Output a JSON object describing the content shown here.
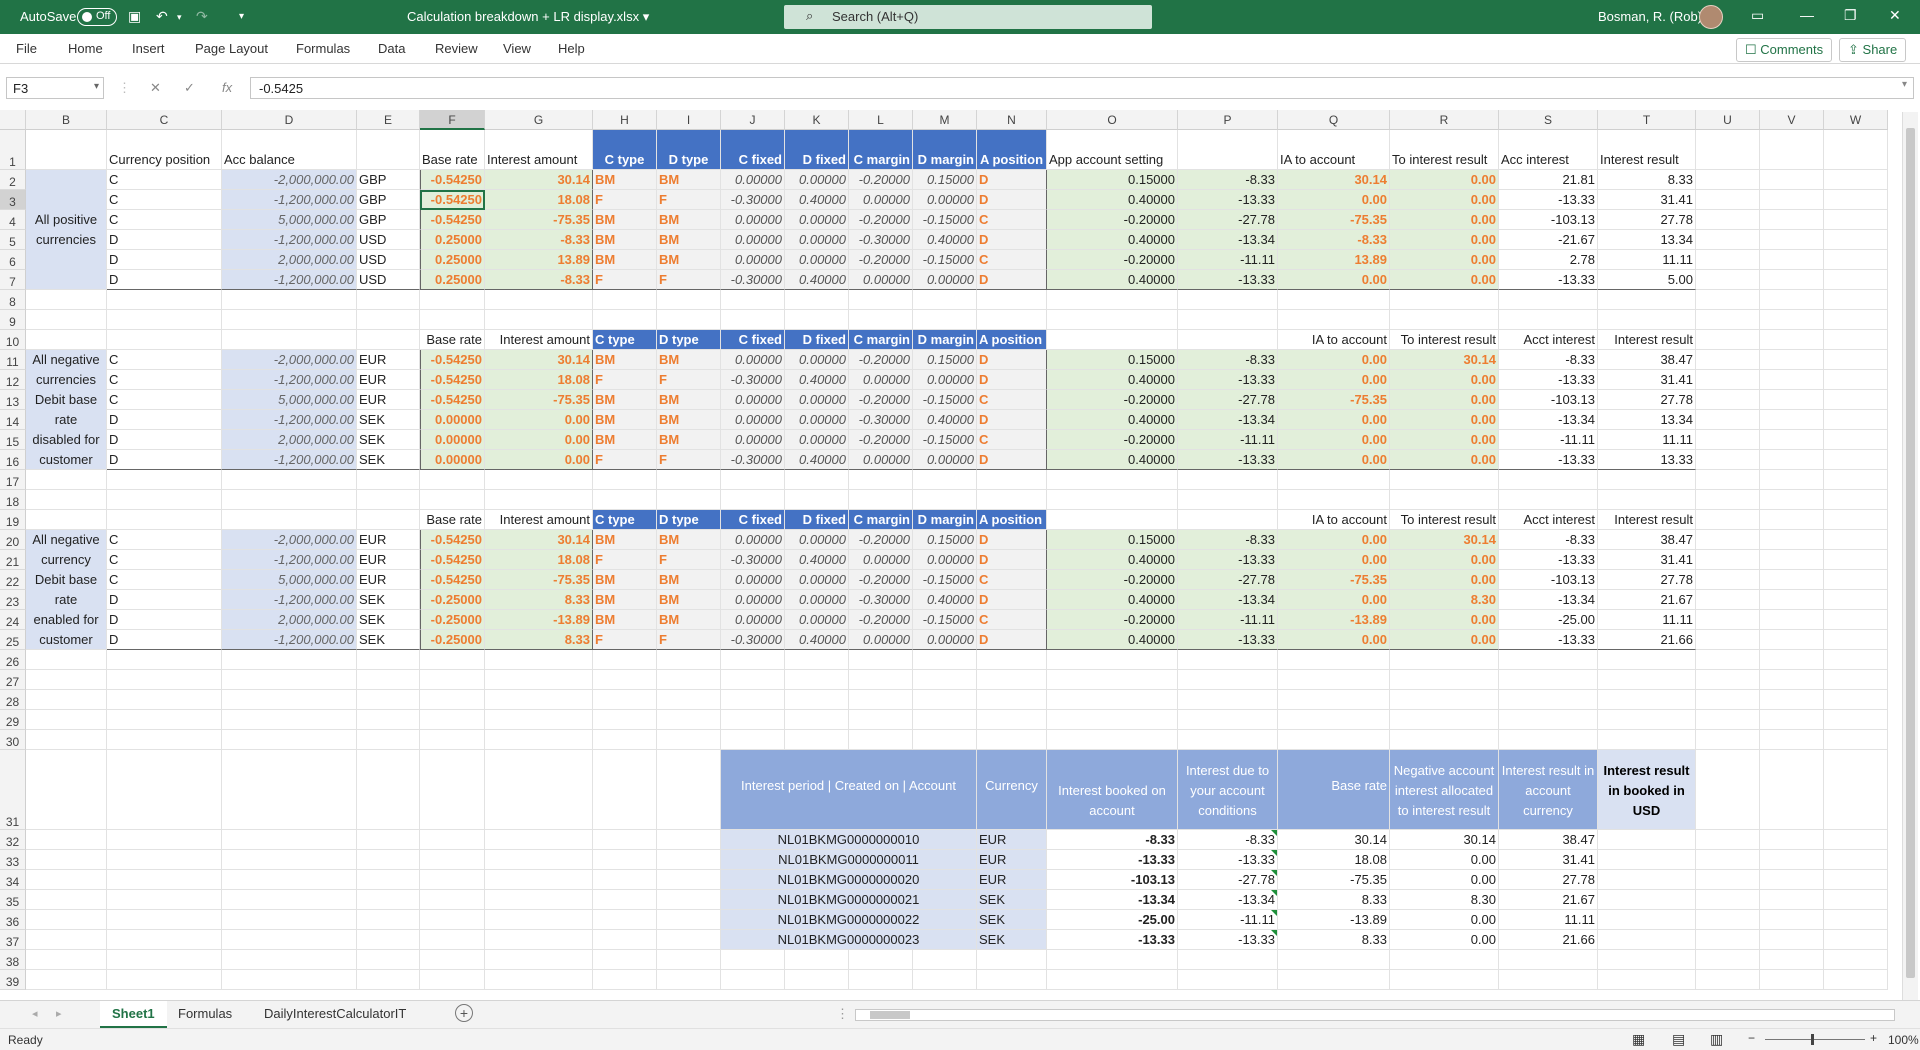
{
  "titlebar": {
    "autosave": "AutoSave",
    "autosave_state": "Off",
    "filename": "Calculation breakdown + LR display.xlsx",
    "search_placeholder": "Search (Alt+Q)",
    "user": "Bosman, R. (Rob)"
  },
  "menu": [
    "File",
    "Home",
    "Insert",
    "Page Layout",
    "Formulas",
    "Data",
    "Review",
    "View",
    "Help"
  ],
  "buttons": {
    "comments": "Comments",
    "share": "Share"
  },
  "formula_bar": {
    "name_box": "F3",
    "value": "-0.5425"
  },
  "columns": [
    "B",
    "C",
    "D",
    "E",
    "F",
    "G",
    "H",
    "I",
    "J",
    "K",
    "L",
    "M",
    "N",
    "O",
    "P",
    "Q",
    "R",
    "S",
    "T",
    "U",
    "V",
    "W"
  ],
  "rows": [
    "1",
    "2",
    "3",
    "4",
    "5",
    "6",
    "7",
    "8",
    "9",
    "10",
    "11",
    "12",
    "13",
    "14",
    "15",
    "16",
    "17",
    "18",
    "19",
    "20",
    "21",
    "22",
    "23",
    "24",
    "25",
    "26",
    "27",
    "28",
    "29",
    "30",
    "31",
    "32",
    "33",
    "34",
    "35",
    "36",
    "37",
    "38",
    "39"
  ],
  "header1": {
    "C": "Currency position",
    "D": "Acc balance",
    "F": "Base rate",
    "G": "Interest amount",
    "H": "C type",
    "I": "D type",
    "J": "C fixed",
    "K": "D fixed",
    "L": "C margin",
    "M": "D margin",
    "N": "A position",
    "O": "App account setting",
    "Q": "IA to account",
    "R": "To interest result",
    "S": "Acc interest",
    "T": "Interest result"
  },
  "header2": {
    "F": "Base rate",
    "G": "Interest amount",
    "H": "C type",
    "I": "D type",
    "J": "C fixed",
    "K": "D fixed",
    "L": "C margin",
    "M": "D margin",
    "N": "A position",
    "Q": "IA to account",
    "R": "To interest result",
    "S": "Acct interest",
    "T": "Interest result"
  },
  "group_labels": {
    "g1": [
      "All positive",
      "currencies"
    ],
    "g2": [
      "All negative",
      "currencies",
      "Debit base",
      "rate",
      "disabled for",
      "customer"
    ],
    "g3": [
      "All negative",
      "currency",
      "Debit base",
      "rate",
      "enabled for",
      "customer"
    ]
  },
  "block1": [
    [
      "C",
      "-2,000,000.00",
      "GBP",
      "-0.54250",
      "30.14",
      "BM",
      "BM",
      "0.00000",
      "0.00000",
      "-0.20000",
      "0.15000",
      "D",
      "0.15000",
      "-8.33",
      "30.14",
      "0.00",
      "21.81",
      "8.33"
    ],
    [
      "C",
      "-1,200,000.00",
      "GBP",
      "-0.54250",
      "18.08",
      "F",
      "F",
      "-0.30000",
      "0.40000",
      "0.00000",
      "0.00000",
      "D",
      "0.40000",
      "-13.33",
      "0.00",
      "0.00",
      "-13.33",
      "31.41"
    ],
    [
      "C",
      "5,000,000.00",
      "GBP",
      "-0.54250",
      "-75.35",
      "BM",
      "BM",
      "0.00000",
      "0.00000",
      "-0.20000",
      "-0.15000",
      "C",
      "-0.20000",
      "-27.78",
      "-75.35",
      "0.00",
      "-103.13",
      "27.78"
    ],
    [
      "D",
      "-1,200,000.00",
      "USD",
      "0.25000",
      "-8.33",
      "BM",
      "BM",
      "0.00000",
      "0.00000",
      "-0.30000",
      "0.40000",
      "D",
      "0.40000",
      "-13.34",
      "-8.33",
      "0.00",
      "-21.67",
      "13.34"
    ],
    [
      "D",
      "2,000,000.00",
      "USD",
      "0.25000",
      "13.89",
      "BM",
      "BM",
      "0.00000",
      "0.00000",
      "-0.20000",
      "-0.15000",
      "C",
      "-0.20000",
      "-11.11",
      "13.89",
      "0.00",
      "2.78",
      "11.11"
    ],
    [
      "D",
      "-1,200,000.00",
      "USD",
      "0.25000",
      "-8.33",
      "F",
      "F",
      "-0.30000",
      "0.40000",
      "0.00000",
      "0.00000",
      "D",
      "0.40000",
      "-13.33",
      "0.00",
      "0.00",
      "-13.33",
      "5.00"
    ]
  ],
  "block2": [
    [
      "C",
      "-2,000,000.00",
      "EUR",
      "-0.54250",
      "30.14",
      "BM",
      "BM",
      "0.00000",
      "0.00000",
      "-0.20000",
      "0.15000",
      "D",
      "0.15000",
      "-8.33",
      "0.00",
      "30.14",
      "-8.33",
      "38.47"
    ],
    [
      "C",
      "-1,200,000.00",
      "EUR",
      "-0.54250",
      "18.08",
      "F",
      "F",
      "-0.30000",
      "0.40000",
      "0.00000",
      "0.00000",
      "D",
      "0.40000",
      "-13.33",
      "0.00",
      "0.00",
      "-13.33",
      "31.41"
    ],
    [
      "C",
      "5,000,000.00",
      "EUR",
      "-0.54250",
      "-75.35",
      "BM",
      "BM",
      "0.00000",
      "0.00000",
      "-0.20000",
      "-0.15000",
      "C",
      "-0.20000",
      "-27.78",
      "-75.35",
      "0.00",
      "-103.13",
      "27.78"
    ],
    [
      "D",
      "-1,200,000.00",
      "SEK",
      "0.00000",
      "0.00",
      "BM",
      "BM",
      "0.00000",
      "0.00000",
      "-0.30000",
      "0.40000",
      "D",
      "0.40000",
      "-13.34",
      "0.00",
      "0.00",
      "-13.34",
      "13.34"
    ],
    [
      "D",
      "2,000,000.00",
      "SEK",
      "0.00000",
      "0.00",
      "BM",
      "BM",
      "0.00000",
      "0.00000",
      "-0.20000",
      "-0.15000",
      "C",
      "-0.20000",
      "-11.11",
      "0.00",
      "0.00",
      "-11.11",
      "11.11"
    ],
    [
      "D",
      "-1,200,000.00",
      "SEK",
      "0.00000",
      "0.00",
      "F",
      "F",
      "-0.30000",
      "0.40000",
      "0.00000",
      "0.00000",
      "D",
      "0.40000",
      "-13.33",
      "0.00",
      "0.00",
      "-13.33",
      "13.33"
    ]
  ],
  "block3": [
    [
      "C",
      "-2,000,000.00",
      "EUR",
      "-0.54250",
      "30.14",
      "BM",
      "BM",
      "0.00000",
      "0.00000",
      "-0.20000",
      "0.15000",
      "D",
      "0.15000",
      "-8.33",
      "0.00",
      "30.14",
      "-8.33",
      "38.47"
    ],
    [
      "C",
      "-1,200,000.00",
      "EUR",
      "-0.54250",
      "18.08",
      "F",
      "F",
      "-0.30000",
      "0.40000",
      "0.00000",
      "0.00000",
      "D",
      "0.40000",
      "-13.33",
      "0.00",
      "0.00",
      "-13.33",
      "31.41"
    ],
    [
      "C",
      "5,000,000.00",
      "EUR",
      "-0.54250",
      "-75.35",
      "BM",
      "BM",
      "0.00000",
      "0.00000",
      "-0.20000",
      "-0.15000",
      "C",
      "-0.20000",
      "-27.78",
      "-75.35",
      "0.00",
      "-103.13",
      "27.78"
    ],
    [
      "D",
      "-1,200,000.00",
      "SEK",
      "-0.25000",
      "8.33",
      "BM",
      "BM",
      "0.00000",
      "0.00000",
      "-0.30000",
      "0.40000",
      "D",
      "0.40000",
      "-13.34",
      "0.00",
      "8.30",
      "-13.34",
      "21.67"
    ],
    [
      "D",
      "2,000,000.00",
      "SEK",
      "-0.25000",
      "-13.89",
      "BM",
      "BM",
      "0.00000",
      "0.00000",
      "-0.20000",
      "-0.15000",
      "C",
      "-0.20000",
      "-11.11",
      "-13.89",
      "0.00",
      "-25.00",
      "11.11"
    ],
    [
      "D",
      "-1,200,000.00",
      "SEK",
      "-0.25000",
      "8.33",
      "F",
      "F",
      "-0.30000",
      "0.40000",
      "0.00000",
      "0.00000",
      "D",
      "0.40000",
      "-13.33",
      "0.00",
      "0.00",
      "-13.33",
      "21.66"
    ]
  ],
  "summary_headers": [
    "Interest period | Created on | Account",
    "Currency",
    "Interest booked on account",
    "Interest due to your account conditions",
    "Base rate",
    "Negative account interest allocated to interest result",
    "Interest result in account currency",
    "Interest result in booked in USD"
  ],
  "summary_rows": [
    [
      "NL01BKMG0000000010",
      "EUR",
      "-8.33",
      "-8.33",
      "30.14",
      "30.14",
      "38.47"
    ],
    [
      "NL01BKMG0000000011",
      "EUR",
      "-13.33",
      "-13.33",
      "18.08",
      "0.00",
      "31.41"
    ],
    [
      "NL01BKMG0000000020",
      "EUR",
      "-103.13",
      "-27.78",
      "-75.35",
      "0.00",
      "27.78"
    ],
    [
      "NL01BKMG0000000021",
      "SEK",
      "-13.34",
      "-13.34",
      "8.33",
      "8.30",
      "21.67"
    ],
    [
      "NL01BKMG0000000022",
      "SEK",
      "-25.00",
      "-11.11",
      "-13.89",
      "0.00",
      "11.11"
    ],
    [
      "NL01BKMG0000000023",
      "SEK",
      "-13.33",
      "-13.33",
      "8.33",
      "0.00",
      "21.66"
    ]
  ],
  "sheets": [
    "Sheet1",
    "Formulas",
    "DailyInterestCalculatorIT"
  ],
  "status": {
    "ready": "Ready",
    "zoom": "100%"
  },
  "colors": {
    "excel_green": "#217346",
    "blue_header": "#4472c4",
    "light_blue": "#d9e1f2",
    "light_green": "#e2efda",
    "orange": "#ed7d31",
    "summary_blue": "#8ea9db"
  }
}
